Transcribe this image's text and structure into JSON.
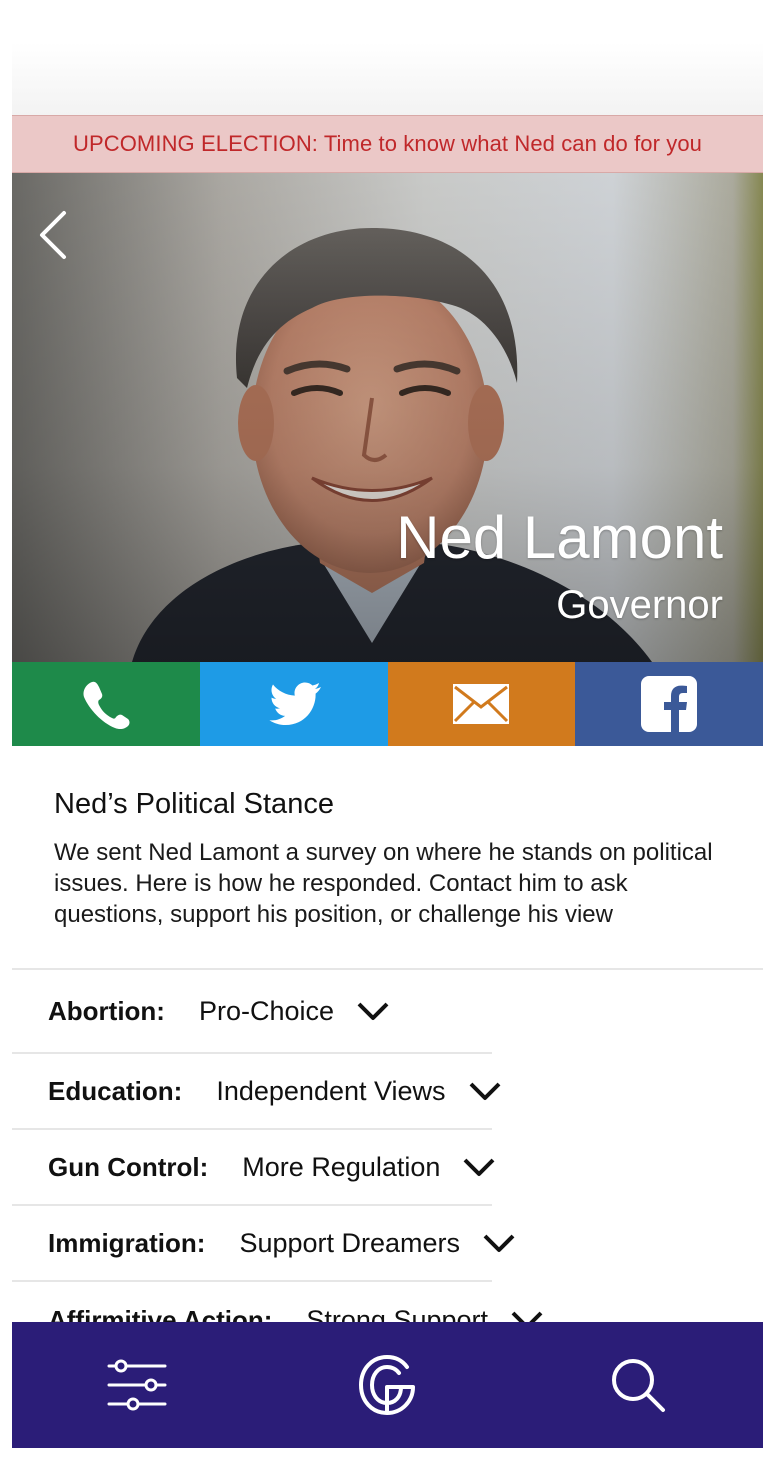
{
  "banner": {
    "text": "UPCOMING ELECTION: Time to know what Ned can do for you",
    "color": "#c0282a",
    "background": "#ebc8c7"
  },
  "hero": {
    "back_icon": "chevron-left-icon",
    "name": "Ned Lamont",
    "title": "Governor"
  },
  "contact": [
    {
      "icon": "phone-icon",
      "color": "#1e8a4a"
    },
    {
      "icon": "twitter-icon",
      "color": "#1e9be6"
    },
    {
      "icon": "mail-icon",
      "color": "#d17a1d"
    },
    {
      "icon": "facebook-icon",
      "color": "#3b5998"
    }
  ],
  "stance": {
    "title": "Ned’s Political Stance",
    "description": "We sent Ned Lamont a survey on where he stands on political issues. Here is how he responded. Contact him to ask questions, support his position, or challenge his view"
  },
  "issues": [
    {
      "label": "Abortion:",
      "value": "Pro-Choice"
    },
    {
      "label": "Education:",
      "value": "Independent Views"
    },
    {
      "label": "Gun Control:",
      "value": "More Regulation"
    },
    {
      "label": "Immigration:",
      "value": "Support Dreamers"
    },
    {
      "label": "Affirmitive Action:",
      "value": "Strong Support"
    }
  ],
  "bottom_nav": {
    "background": "#2b1d78",
    "items": [
      "sliders-icon",
      "logo-g-icon",
      "search-icon"
    ]
  }
}
